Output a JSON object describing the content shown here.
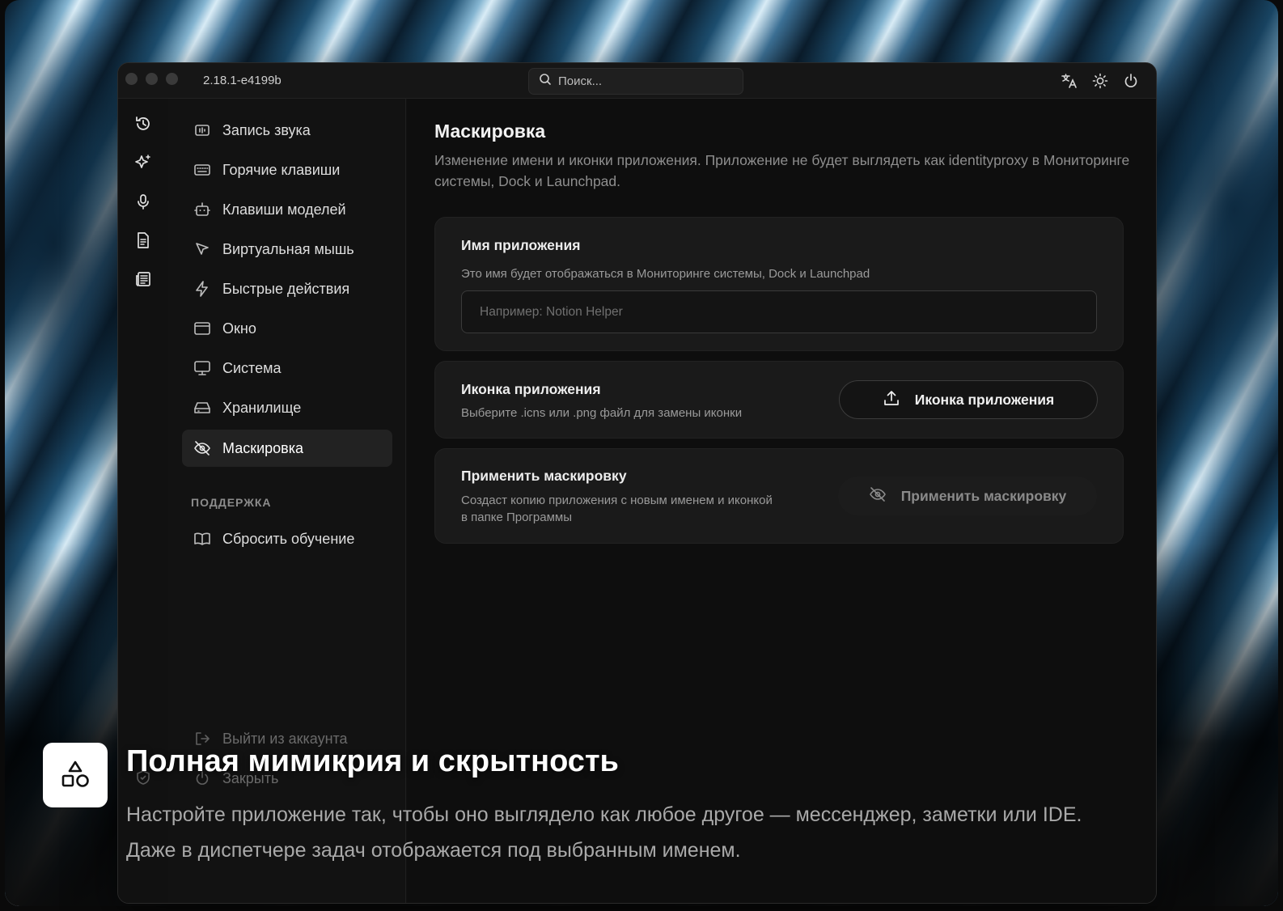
{
  "titlebar": {
    "version": "2.18.1-e4199b",
    "search_placeholder": "Поиск..."
  },
  "sidebar": {
    "items": [
      {
        "label": "Запись звука",
        "icon": "audio-record-icon"
      },
      {
        "label": "Горячие клавиши",
        "icon": "keyboard-icon"
      },
      {
        "label": "Клавиши моделей",
        "icon": "robot-icon"
      },
      {
        "label": "Виртуальная мышь",
        "icon": "cursor-icon"
      },
      {
        "label": "Быстрые действия",
        "icon": "lightning-icon"
      },
      {
        "label": "Окно",
        "icon": "window-icon"
      },
      {
        "label": "Система",
        "icon": "monitor-icon"
      },
      {
        "label": "Хранилище",
        "icon": "storage-icon"
      },
      {
        "label": "Маскировка",
        "icon": "eye-off-icon",
        "active": true
      }
    ],
    "support_label": "ПОДДЕРЖКА",
    "support_items": [
      {
        "label": "Сбросить обучение",
        "icon": "book-icon"
      }
    ],
    "bottom_items": [
      {
        "label": "Выйти из аккаунта",
        "icon": "logout-icon"
      },
      {
        "label": "Закрыть",
        "icon": "power-icon"
      }
    ]
  },
  "main": {
    "title": "Маскировка",
    "description": "Изменение имени и иконки приложения. Приложение не будет выглядеть как identityproxy в Мониторинге системы, Dock и Launchpad.",
    "app_name_card": {
      "title": "Имя приложения",
      "subtitle": "Это имя будет отображаться в Мониторинге системы, Dock и Launchpad",
      "input_value": "",
      "input_placeholder": "Например: Notion Helper"
    },
    "app_icon_card": {
      "title": "Иконка приложения",
      "subtitle": "Выберите .icns или .png файл для замены иконки",
      "button_label": "Иконка приложения"
    },
    "apply_card": {
      "title": "Применить маскировку",
      "subtitle_line1": "Создаст копию приложения с новым именем и иконкой",
      "subtitle_line2": "в папке Программы",
      "button_label": "Применить маскировку"
    }
  },
  "caption": {
    "title": "Полная мимикрия и скрытность",
    "line1": "Настройте приложение так, чтобы оно выглядело как любое другое — мессенджер, заметки или IDE.",
    "line2": "Даже в диспетчере задач отображается под выбранным именем."
  },
  "colors": {
    "window_bg": "#111111",
    "card_bg": "#1a1a1a",
    "active_item_bg": "#222222",
    "text_primary": "#ededed",
    "text_muted": "#8e8e8e"
  }
}
